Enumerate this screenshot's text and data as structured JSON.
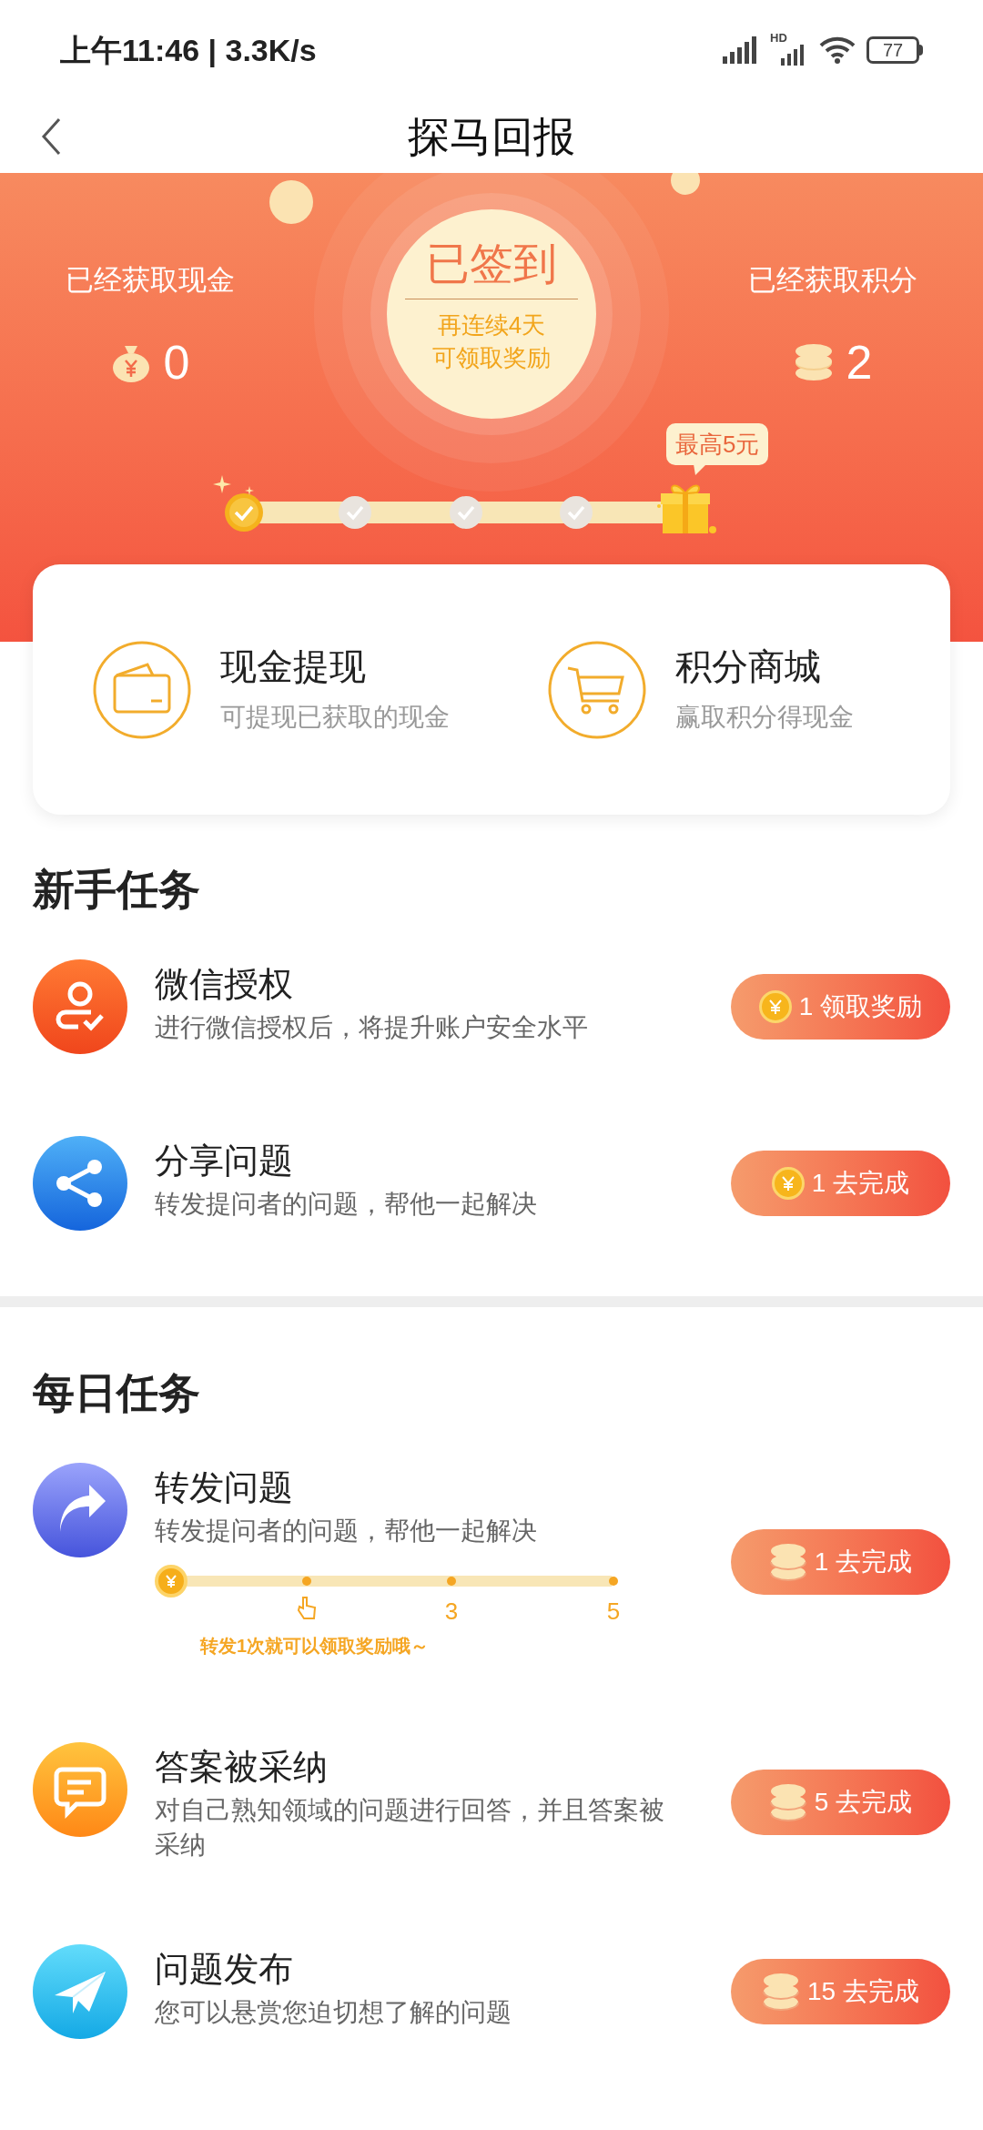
{
  "status_bar": {
    "time": "上午11:46 | 3.3K/s",
    "network_label": "HD",
    "battery": "77"
  },
  "header": {
    "title": "探马回报"
  },
  "banner": {
    "cash": {
      "label": "已经获取现金",
      "value": "0"
    },
    "points": {
      "label": "已经获取积分",
      "value": "2"
    },
    "checkin": {
      "title": "已签到",
      "lines": [
        "再连续4天",
        "可领取奖励"
      ]
    },
    "days": [
      {
        "checked": true
      },
      {
        "checked": false
      },
      {
        "checked": false
      },
      {
        "checked": false
      }
    ],
    "reward_bubble": "最高5元"
  },
  "shortcuts": [
    {
      "kind": "wallet",
      "title": "现金提现",
      "subtitle": "可提现已获取的现金"
    },
    {
      "kind": "cart",
      "title": "积分商城",
      "subtitle": "赢取积分得现金"
    }
  ],
  "sections": [
    {
      "title": "新手任务",
      "tasks": [
        {
          "kind": "person",
          "title": "微信授权",
          "description": "进行微信授权后，将提升账户安全水平",
          "button": {
            "kind": "yuan",
            "amount": "1",
            "label": "领取奖励"
          }
        },
        {
          "kind": "share",
          "title": "分享问题",
          "description": "转发提问者的问题，帮他一起解决",
          "button": {
            "kind": "yuan",
            "amount": "1",
            "label": "去完成"
          }
        }
      ]
    },
    {
      "title": "每日任务",
      "tasks": [
        {
          "kind": "forward",
          "title": "转发问题",
          "description": "转发提问者的问题，帮他一起解决",
          "button": {
            "kind": "stack",
            "amount": "1",
            "label": "去完成"
          },
          "progress": {
            "marks": [
              {
                "kind": "hand"
              },
              {
                "kind": "label",
                "label": "3"
              },
              {
                "kind": "label",
                "label": "5"
              }
            ],
            "hint": "转发1次就可以领取奖励哦～"
          }
        },
        {
          "kind": "chat",
          "title": "答案被采纳",
          "description": "对自己熟知领域的问题进行回答，并且答案被采纳",
          "button": {
            "kind": "stack",
            "amount": "5",
            "label": "去完成"
          }
        },
        {
          "kind": "plane",
          "title": "问题发布",
          "description": "您可以悬赏您迫切想了解的问题",
          "button": {
            "kind": "stack",
            "amount": "15",
            "label": "去完成"
          }
        }
      ]
    }
  ]
}
